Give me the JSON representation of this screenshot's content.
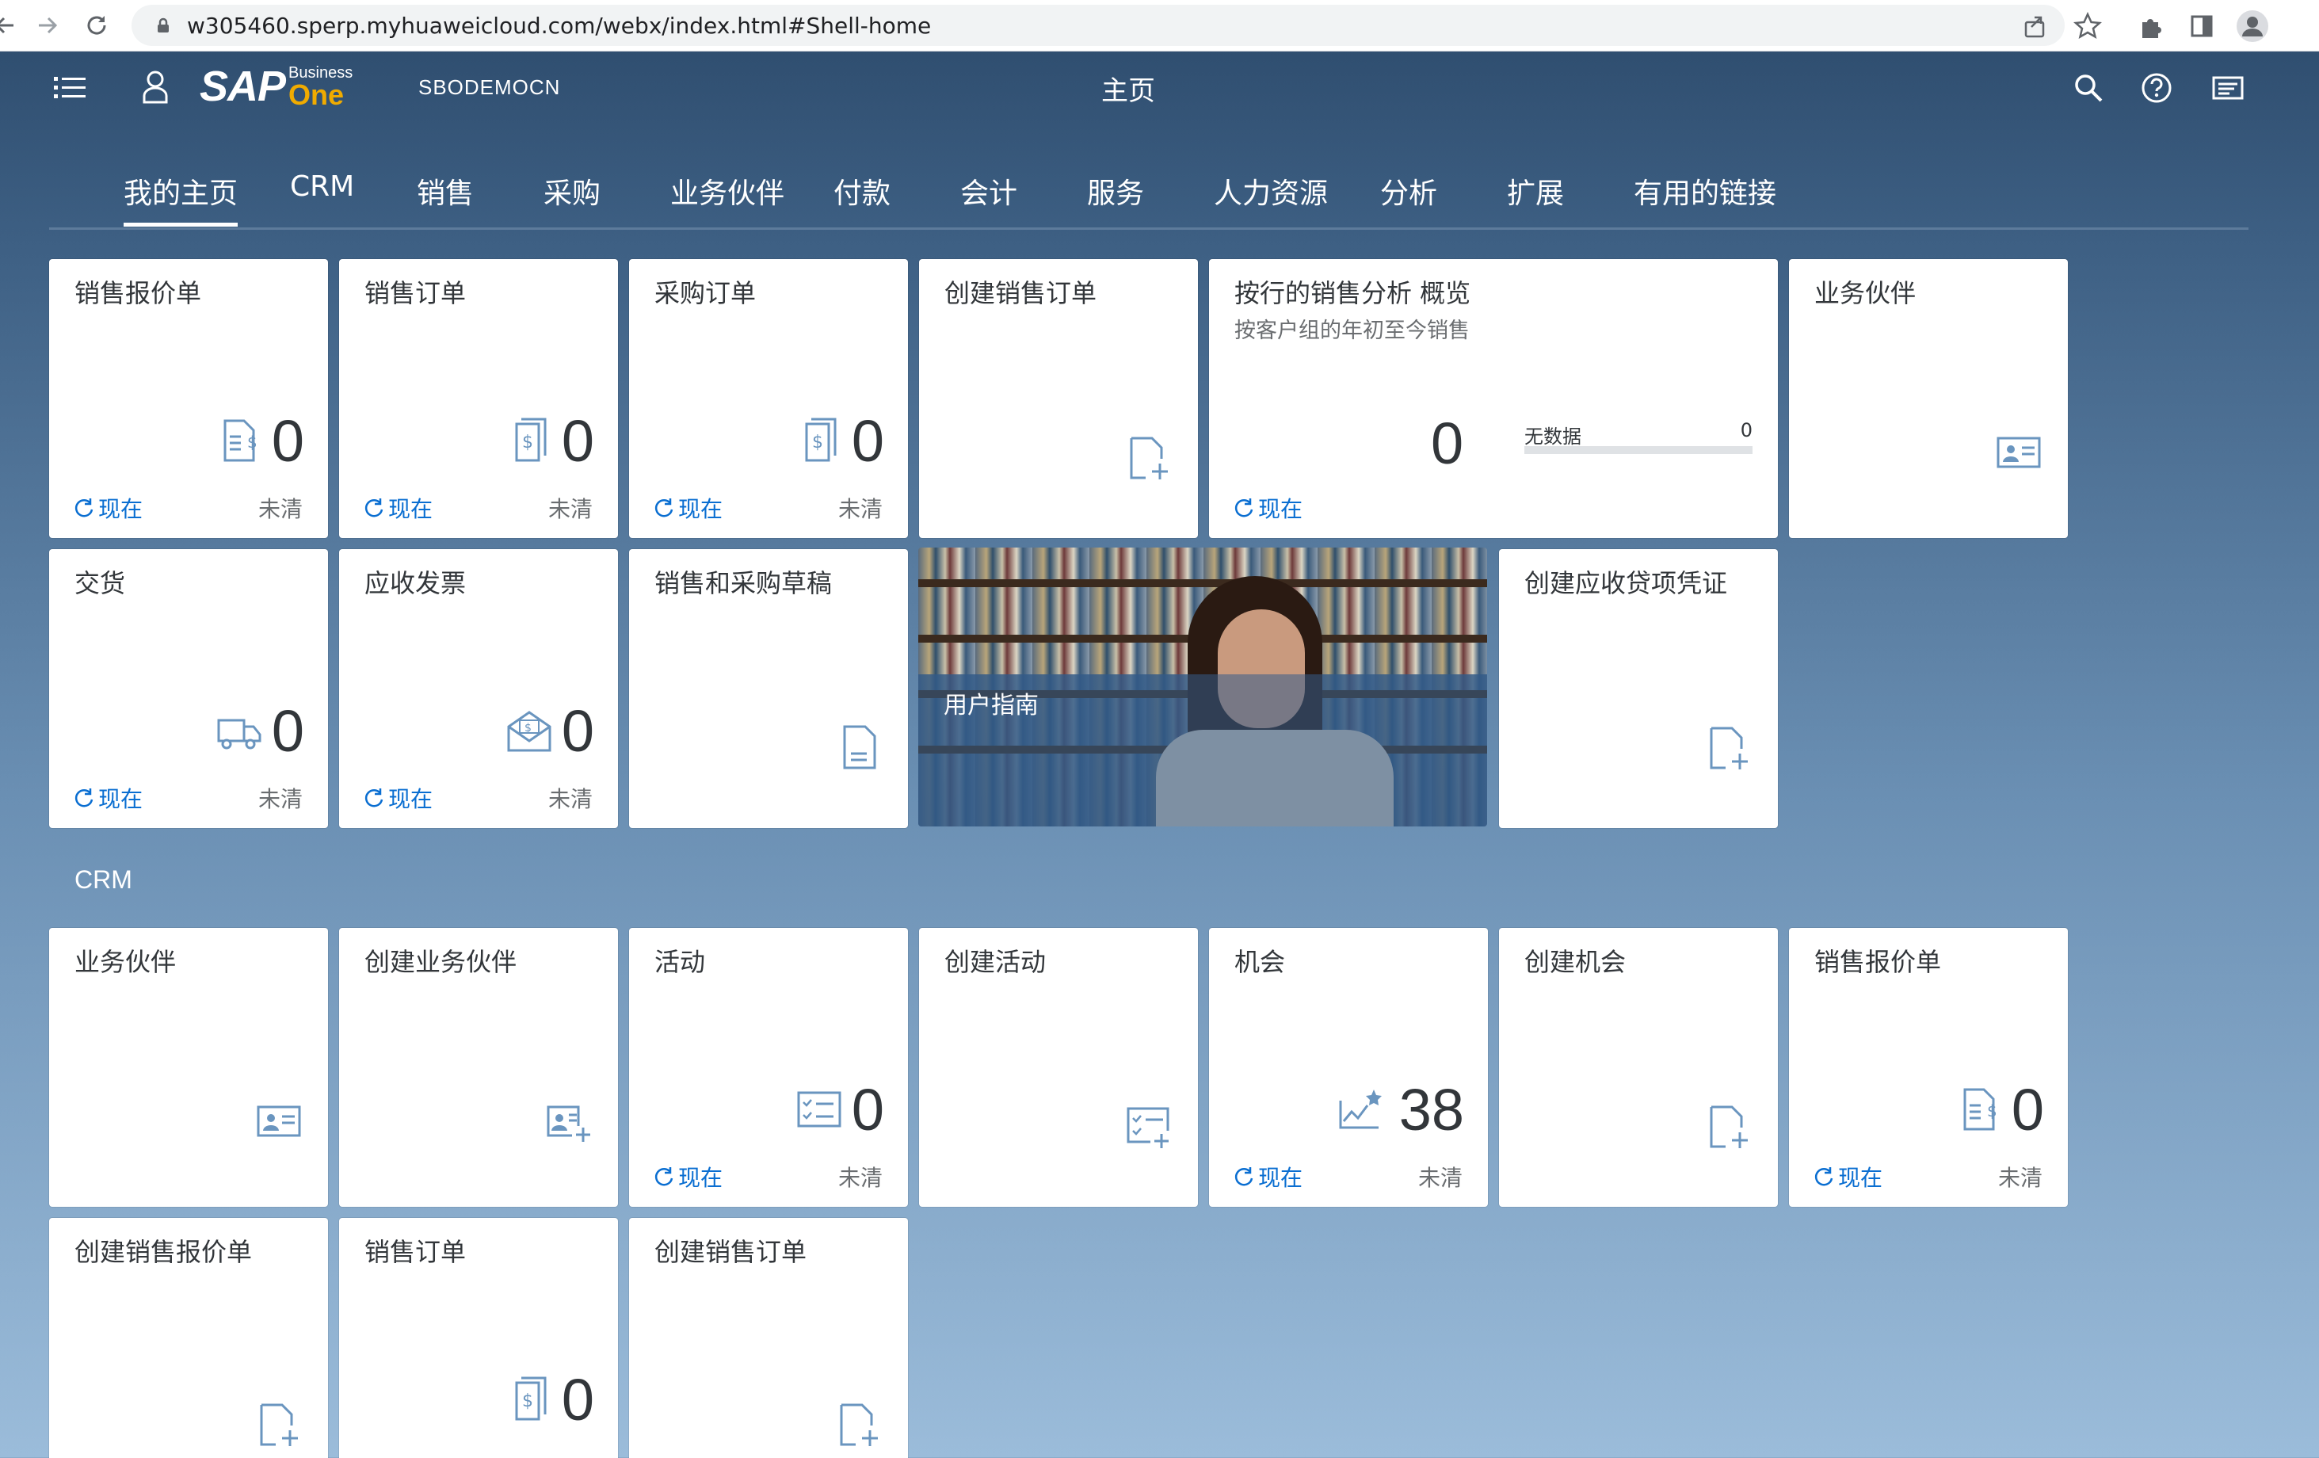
{
  "browser": {
    "url": "w305460.sperp.myhuaweicloud.com/webx/index.html#Shell-home"
  },
  "shell": {
    "logo_sap": "SAP",
    "logo_business": "Business",
    "logo_one": "One",
    "company": "SBODEMOCN",
    "title": "主页"
  },
  "tabs": [
    {
      "label": "我的主页",
      "active": true
    },
    {
      "label": "CRM"
    },
    {
      "label": "销售"
    },
    {
      "label": "采购"
    },
    {
      "label": "业务伙伴"
    },
    {
      "label": "付款"
    },
    {
      "label": "会计"
    },
    {
      "label": "服务"
    },
    {
      "label": "人力资源"
    },
    {
      "label": "分析"
    },
    {
      "label": "扩展"
    },
    {
      "label": "有用的链接"
    }
  ],
  "common": {
    "refresh_label": "现在",
    "unit_label": "未清"
  },
  "home": {
    "t1": {
      "title": "销售报价单",
      "value": "0",
      "icon": "document-dollar-icon"
    },
    "t2": {
      "title": "销售订单",
      "value": "0",
      "icon": "dollar-document-icon"
    },
    "t3": {
      "title": "采购订单",
      "value": "0",
      "icon": "dollar-document-icon"
    },
    "t4": {
      "title": "创建销售订单",
      "icon": "add-document-icon"
    },
    "t5": {
      "title": "按行的销售分析 概览",
      "subtitle": "按客户组的年初至今销售",
      "value": "0",
      "bar_label": "无数据",
      "bar_value": "0"
    },
    "t6": {
      "title": "业务伙伴",
      "icon": "contact-card-icon"
    },
    "t7": {
      "title": "交货",
      "value": "0",
      "icon": "shipping-truck-icon"
    },
    "t8": {
      "title": "应收发票",
      "value": "0",
      "icon": "invoice-envelope-icon"
    },
    "t9": {
      "title": "销售和采购草稿",
      "icon": "document-icon"
    },
    "t10": {
      "title": "用户指南"
    },
    "t11": {
      "title": "创建应收贷项凭证",
      "icon": "add-document-icon"
    }
  },
  "crm": {
    "section_title": "CRM",
    "c1": {
      "title": "业务伙伴",
      "icon": "contact-card-icon"
    },
    "c2": {
      "title": "创建业务伙伴",
      "icon": "add-contact-icon"
    },
    "c3": {
      "title": "活动",
      "value": "0",
      "icon": "checklist-icon"
    },
    "c4": {
      "title": "创建活动",
      "icon": "add-checklist-icon"
    },
    "c5": {
      "title": "机会",
      "value": "38",
      "icon": "opportunity-chart-icon"
    },
    "c6": {
      "title": "创建机会",
      "icon": "add-document-icon"
    },
    "c7": {
      "title": "销售报价单",
      "value": "0",
      "icon": "document-dollar-icon"
    },
    "c8": {
      "title": "创建销售报价单",
      "icon": "add-document-icon"
    },
    "c9": {
      "title": "销售订单",
      "value": "0",
      "icon": "dollar-document-icon"
    },
    "c10": {
      "title": "创建销售订单",
      "icon": "add-document-icon"
    }
  }
}
